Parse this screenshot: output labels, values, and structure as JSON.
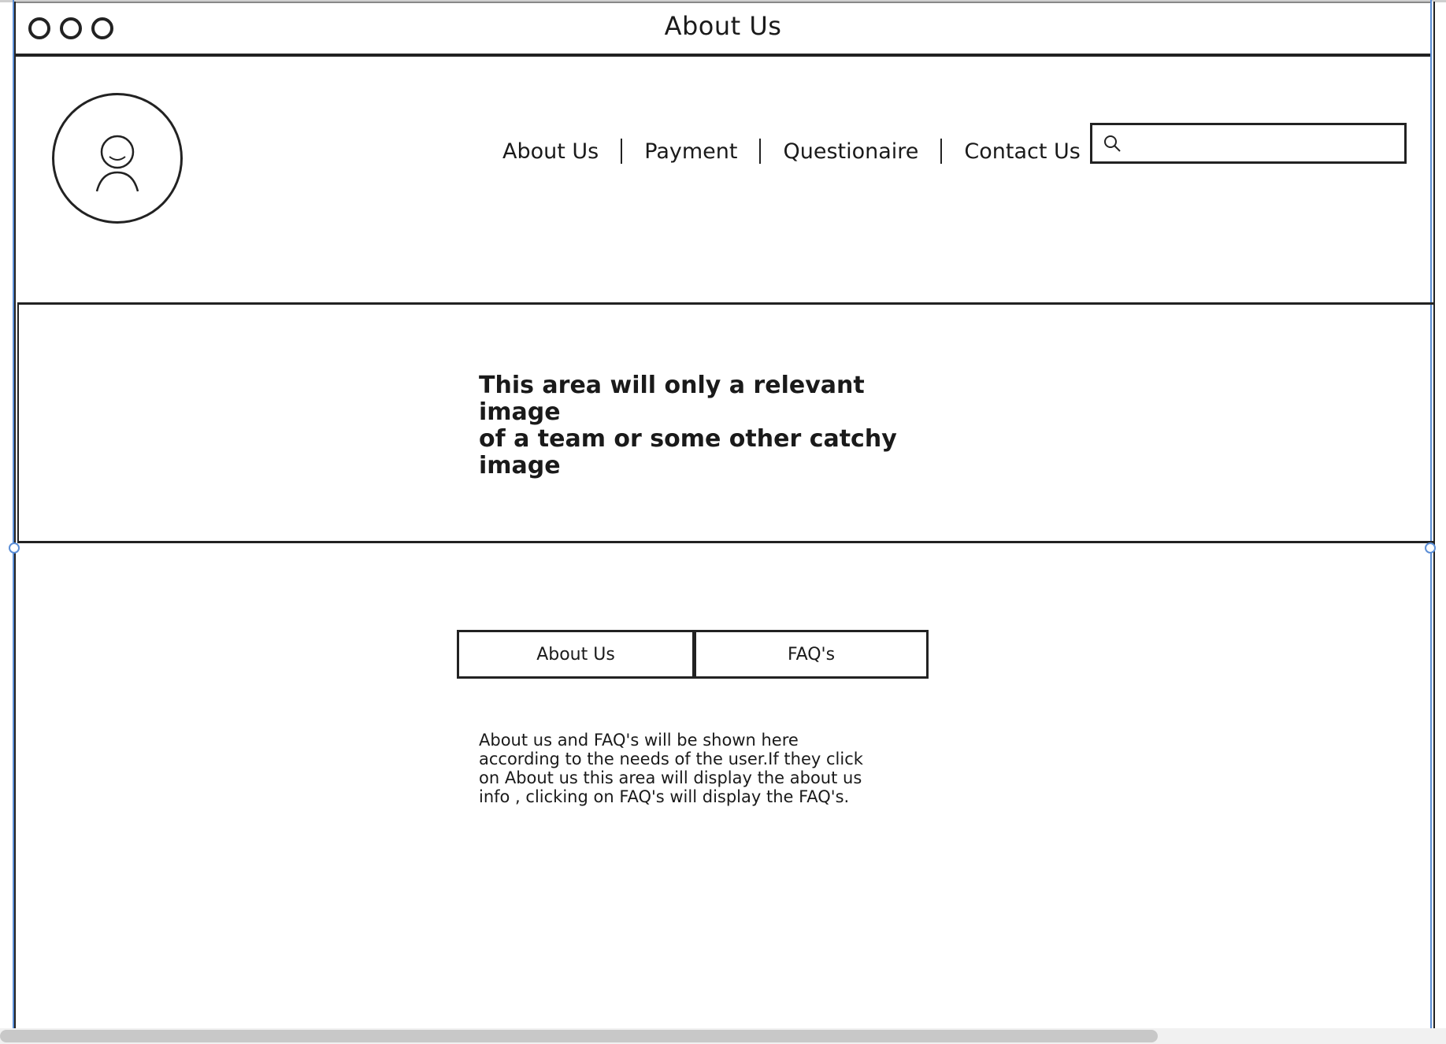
{
  "window": {
    "title": "About Us"
  },
  "nav": {
    "items": [
      "About Us",
      "Payment",
      "Questionaire",
      "Contact Us"
    ]
  },
  "search": {
    "placeholder": "",
    "value": ""
  },
  "hero": {
    "line1": "This area will only a relevant image",
    "line2": "of a team or  some other catchy",
    "line3": "image"
  },
  "tabs": {
    "about_label": "About Us",
    "faq_label": "FAQ's"
  },
  "content": {
    "line1": "About us and FAQ's will be shown here",
    "line2": "according to the needs of the user.If they click",
    "line3": "on About us this area will display the about us",
    "line4": "info , clicking on FAQ's will display the FAQ's."
  },
  "colors": {
    "ink": "#222222",
    "selection": "#5b8ed6",
    "scrollbar": "#c8c8c8"
  },
  "icons": {
    "window_controls": "three-circle-icons",
    "avatar": "user-avatar-icon",
    "search": "search-icon"
  }
}
